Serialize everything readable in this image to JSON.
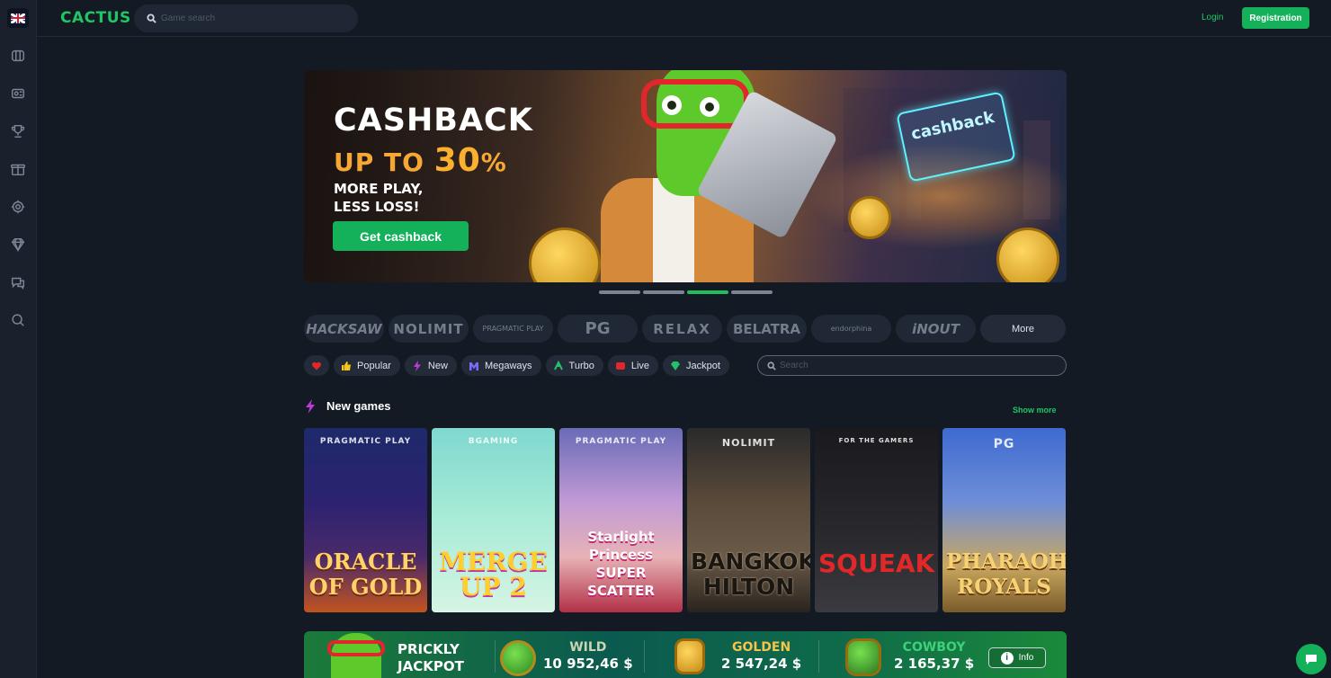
{
  "header": {
    "logo": "CACTUS",
    "search_placeholder": "Game search",
    "login_label": "Login",
    "register_label": "Registration",
    "language_flag": "uk-flag-icon"
  },
  "sidebar": {
    "items": [
      {
        "icon": "slot-machine-icon"
      },
      {
        "icon": "live-casino-icon"
      },
      {
        "icon": "trophy-icon"
      },
      {
        "icon": "gift-icon"
      },
      {
        "icon": "loyalty-icon"
      },
      {
        "icon": "diamond-icon"
      },
      {
        "icon": "chat-bubbles-icon"
      },
      {
        "icon": "search-icon"
      }
    ]
  },
  "banner": {
    "title": "CASHBACK",
    "subtitle_prefix": "UP TO ",
    "subtitle_value": "30",
    "subtitle_suffix": "%",
    "line1": "MORE PLAY,",
    "line2": "LESS LOSS!",
    "button_label": "Get cashback",
    "card_label": "cashback",
    "slides_count": 4,
    "active_slide": 3
  },
  "providers": [
    {
      "label": "HACKSAW"
    },
    {
      "label": "NOLIMIT"
    },
    {
      "label": "PRAGMATIC PLAY"
    },
    {
      "label": "PG"
    },
    {
      "label": "RELAX"
    },
    {
      "label": "BELATRA"
    },
    {
      "label": "endorphina"
    },
    {
      "label": "iNOUT"
    },
    {
      "label": "More"
    }
  ],
  "filters": [
    {
      "label": "",
      "icon": "heart-icon",
      "color": "#e2262b"
    },
    {
      "label": "Popular",
      "icon": "thumbs-up-icon",
      "color": "#f5c518"
    },
    {
      "label": "New",
      "icon": "lightning-icon",
      "color": "#c03adf"
    },
    {
      "label": "Megaways",
      "icon": "megaways-icon",
      "color": "#7a6cff"
    },
    {
      "label": "Turbo",
      "icon": "turbo-icon",
      "color": "#25c06a"
    },
    {
      "label": "Live",
      "icon": "live-icon",
      "color": "#e2262b"
    },
    {
      "label": "Jackpot",
      "icon": "jackpot-icon",
      "color": "#25c06a"
    }
  ],
  "filter_search_placeholder": "Search",
  "section": {
    "title": "New games",
    "show_more": "Show more"
  },
  "games": [
    {
      "provider": "PRAGMATIC PLAY",
      "title": "ORACLE OF GOLD"
    },
    {
      "provider": "BGAMING",
      "title": "MERGE UP 2"
    },
    {
      "provider": "PRAGMATIC PLAY",
      "title": "Starlight Princess SUPER SCATTER"
    },
    {
      "provider": "NOLIMIT",
      "title": "BANGKOK HILTON"
    },
    {
      "provider": "FOR THE GAMERS",
      "title": "SQUEAK"
    },
    {
      "provider": "PG",
      "title": "PHARAOH ROYALS"
    }
  ],
  "jackpot": {
    "name_line1": "PRICKLY",
    "name_line2": "JACKPOT",
    "tiers": [
      {
        "label": "WILD",
        "amount": "10 952,46 $"
      },
      {
        "label": "GOLDEN",
        "amount": "2 547,24 $"
      },
      {
        "label": "COWBOY",
        "amount": "2 165,37 $"
      }
    ],
    "info_label": "Info"
  },
  "colors": {
    "accent": "#1fc664",
    "button": "#15b05a",
    "background": "#141a24"
  }
}
